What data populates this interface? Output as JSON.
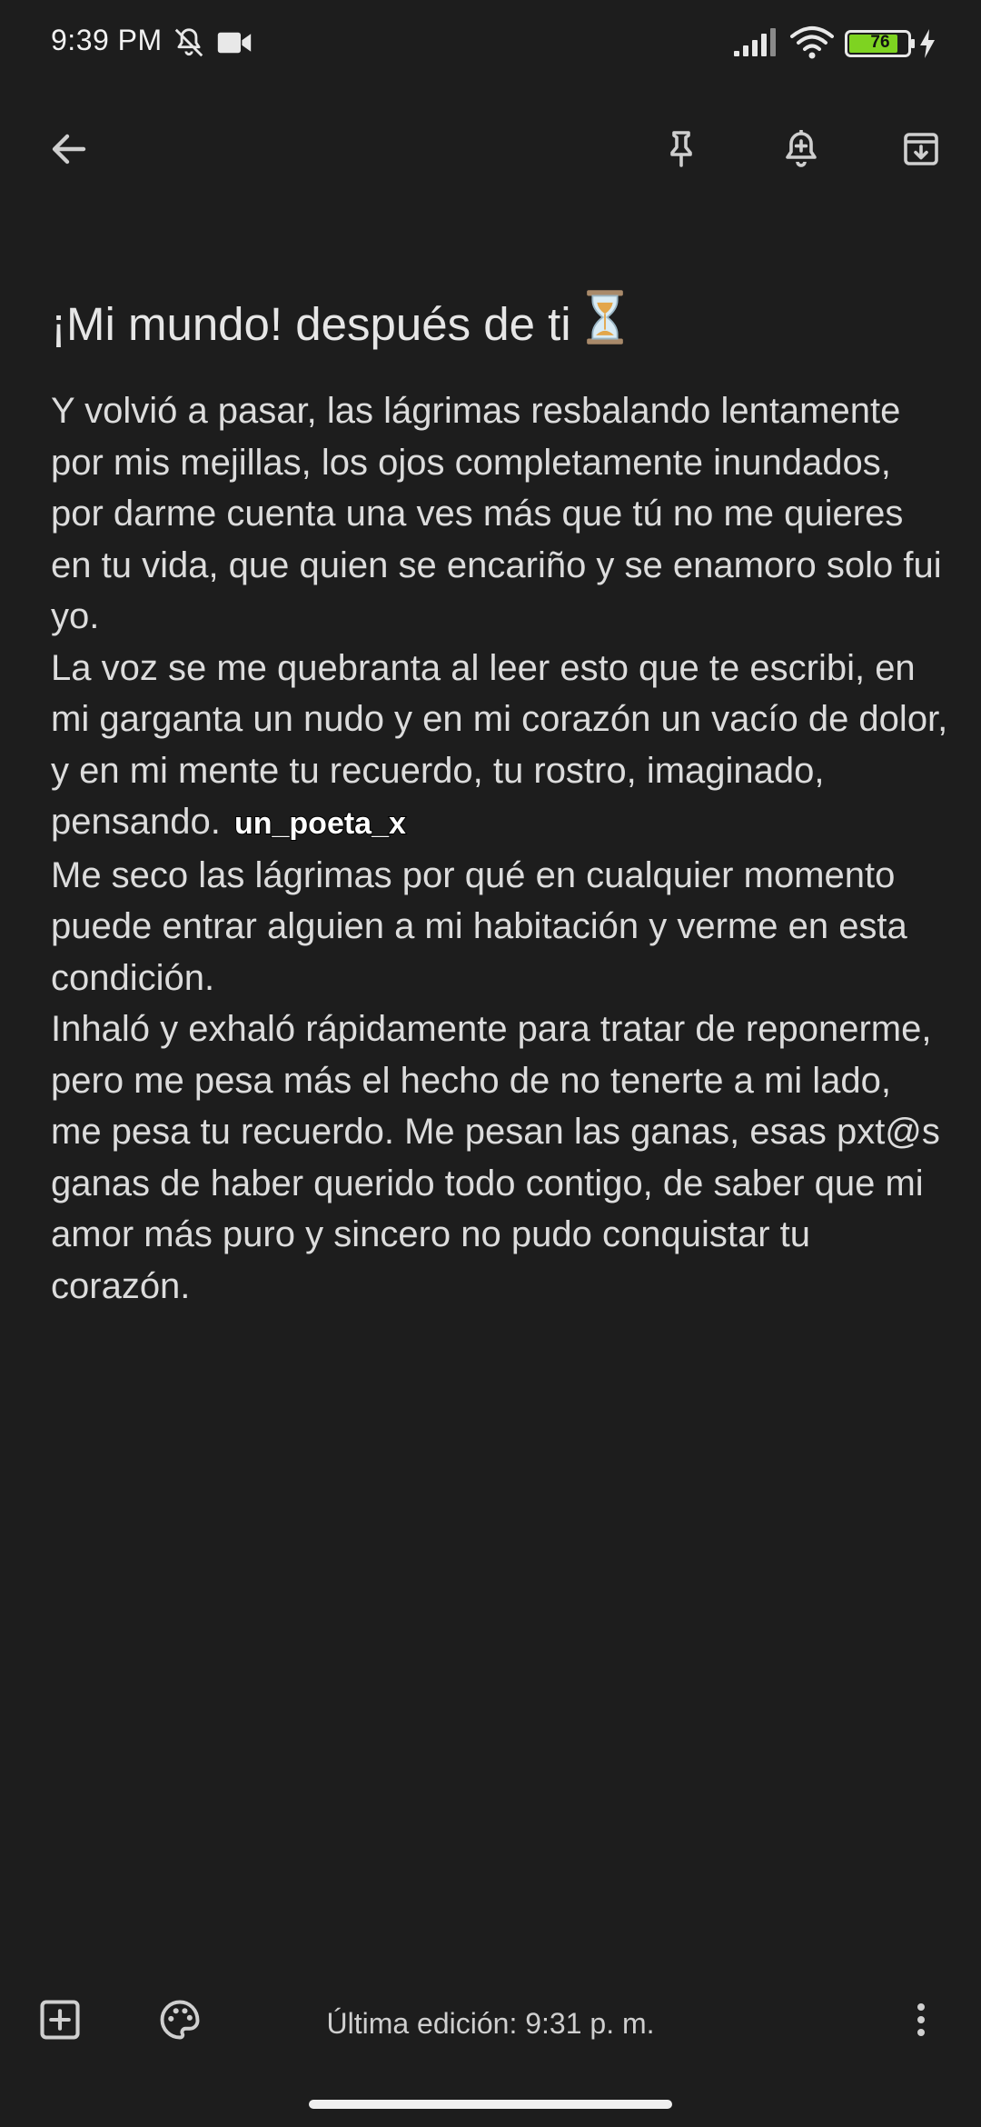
{
  "status_bar": {
    "time": "9:39 PM",
    "battery_level": "76",
    "icons": [
      "bell-off-icon",
      "video-icon",
      "signal-icon",
      "wifi-icon",
      "battery-icon",
      "charging-icon"
    ]
  },
  "toolbar": {
    "icons": [
      "back-arrow-icon",
      "pin-icon",
      "reminder-bell-icon",
      "archive-icon"
    ]
  },
  "note": {
    "title": "¡Mi mundo! después de ti",
    "title_emoji": "hourglass-icon",
    "paragraphs": [
      "Y volvió a pasar, las lágrimas resbalando lentamente por mis mejillas, los ojos completamente inundados, por darme cuenta una ves más que tú no me quieres en tu vida, que quien se encariño y se enamoro solo fui yo.",
      "La voz se me quebranta al leer esto que te escribi, en mi garganta un nudo y en mi corazón un vacío de dolor, y en mi mente tu recuerdo, tu rostro, imaginado, pensando.",
      "Me seco las lágrimas por qué en cualquier momento puede entrar alguien a mi habitación y verme en esta condición.",
      "Inhaló y exhaló rápidamente para tratar de reponerme, pero me pesa más el hecho de no tenerte a mi lado, me pesa tu recuerdo. Me pesan las ganas, esas pxt@s ganas de haber querido todo contigo, de saber que mi amor más puro y sincero no pudo conquistar tu corazón."
    ],
    "watermark": "un_poeta_x"
  },
  "bottom_bar": {
    "last_edited": "Última edición: 9:31 p. m.",
    "icons": [
      "add-box-icon",
      "palette-icon",
      "more-vert-icon"
    ]
  },
  "colors": {
    "background": "#1d1d1d",
    "text": "#dcdcdc",
    "icon": "#cfcfcf",
    "battery_fill": "#7ed321"
  }
}
